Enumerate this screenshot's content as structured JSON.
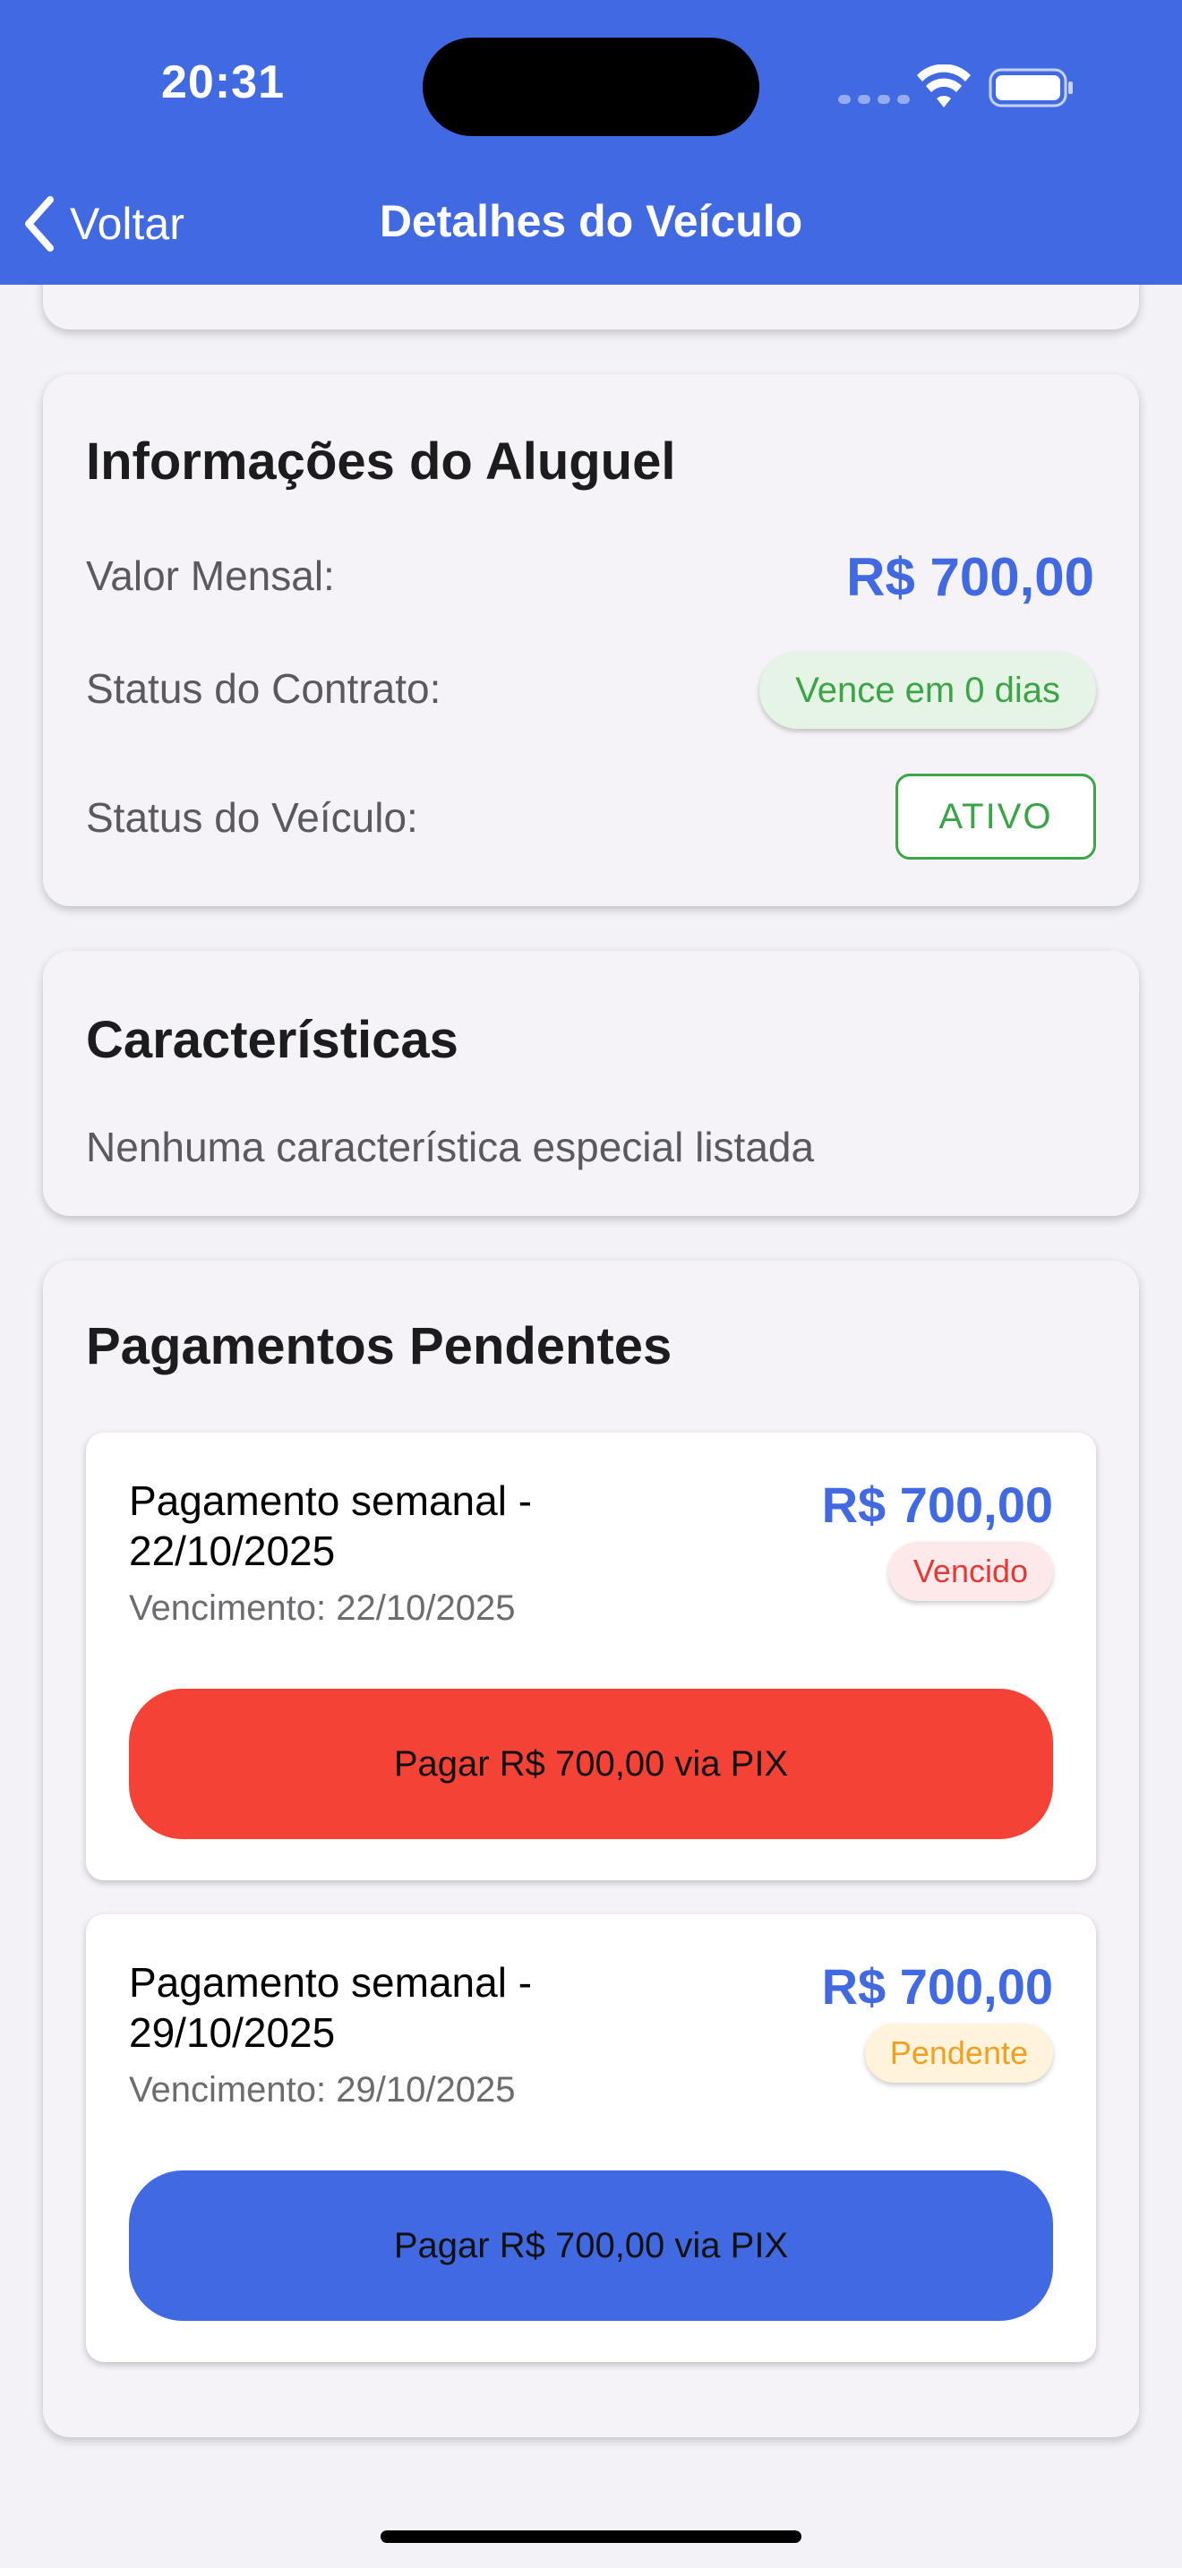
{
  "status_bar": {
    "time": "20:31"
  },
  "nav": {
    "back_label": "Voltar",
    "title": "Detalhes do Veículo"
  },
  "rental": {
    "title": "Informações do Aluguel",
    "monthly_label": "Valor Mensal:",
    "monthly_value": "R$ 700,00",
    "contract_label": "Status do Contrato:",
    "contract_status": "Vence em 0 dias",
    "vehicle_label": "Status do Veículo:",
    "vehicle_status": "ATIVO"
  },
  "features": {
    "title": "Características",
    "empty_text": "Nenhuma característica especial listada"
  },
  "payments": {
    "title": "Pagamentos Pendentes",
    "items": [
      {
        "title": "Pagamento semanal - 22/10/2025",
        "due": "Vencimento: 22/10/2025",
        "amount": "R$ 700,00",
        "status": "Vencido",
        "button": "Pagar R$ 700,00 via PIX"
      },
      {
        "title": "Pagamento semanal - 29/10/2025",
        "due": "Vencimento: 29/10/2025",
        "amount": "R$ 700,00",
        "status": "Pendente",
        "button": "Pagar R$ 700,00 via PIX"
      }
    ]
  },
  "colors": {
    "brand": "#4169e1",
    "success": "#3aa447",
    "danger": "#f44336",
    "warning": "#f0a020"
  },
  "icons": [
    "chevron-left-icon",
    "wifi-icon",
    "battery-icon"
  ]
}
